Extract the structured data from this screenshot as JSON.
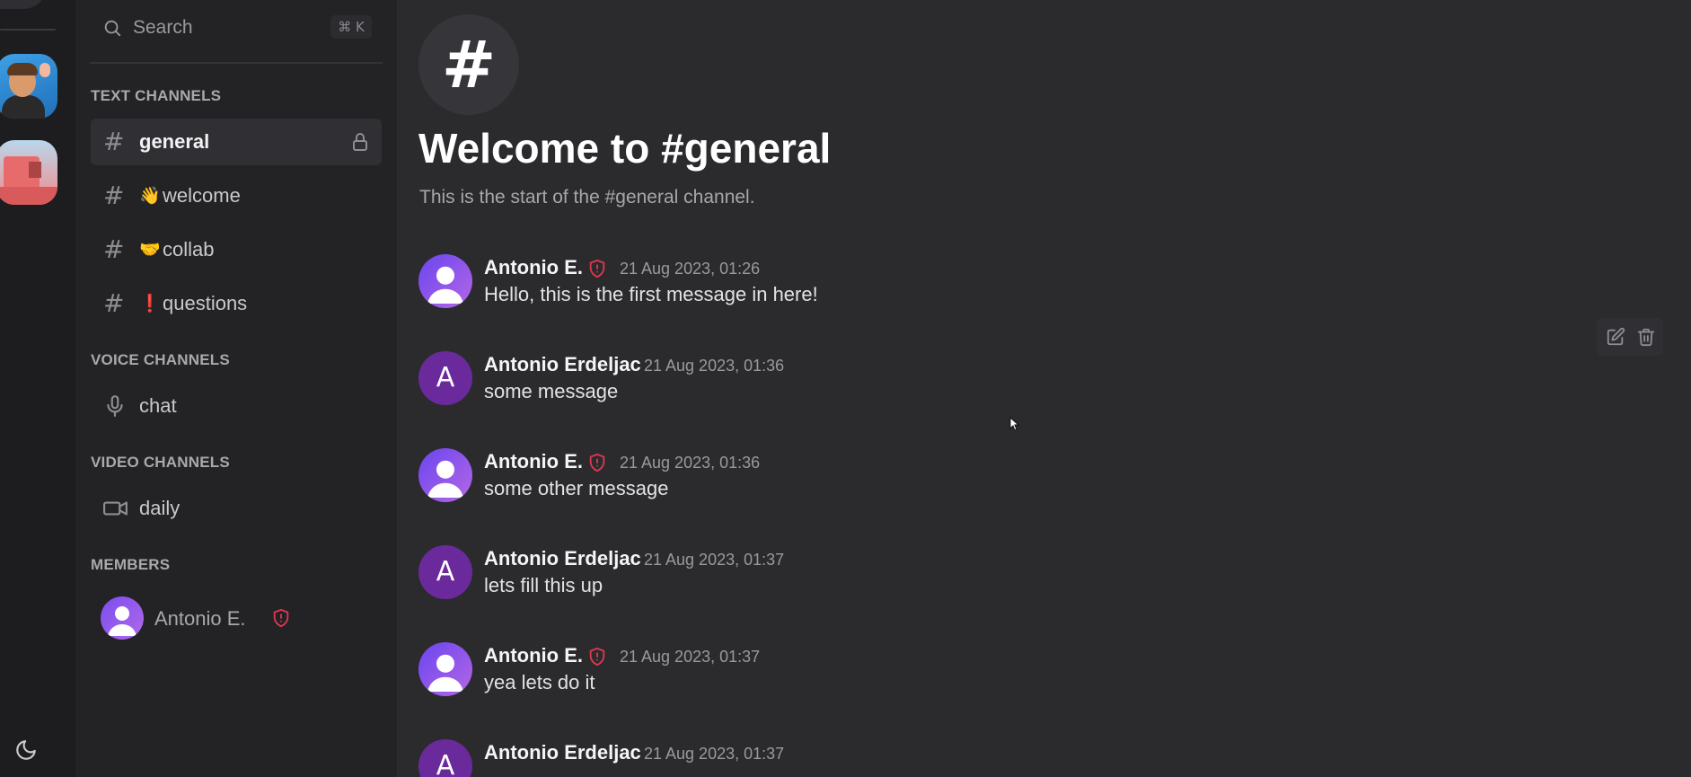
{
  "search": {
    "placeholder": "Search",
    "shortcut": "⌘ K"
  },
  "sections": {
    "text": "TEXT CHANNELS",
    "voice": "VOICE CHANNELS",
    "video": "VIDEO CHANNELS",
    "members": "MEMBERS"
  },
  "text_channels": [
    {
      "label": "general",
      "emoji": "",
      "active": true,
      "locked": true
    },
    {
      "label": "welcome",
      "emoji": "👋",
      "active": false
    },
    {
      "label": "collab",
      "emoji": "🤝",
      "active": false
    },
    {
      "label": "questions",
      "emoji": "❗",
      "active": false
    }
  ],
  "voice_channels": [
    {
      "label": "chat"
    }
  ],
  "video_channels": [
    {
      "label": "daily"
    }
  ],
  "members": [
    {
      "name": "Antonio E.",
      "role_icon": "shield-icon"
    }
  ],
  "main": {
    "channel_symbol": "#",
    "welcome_title": "Welcome to #general",
    "start_text": "This is the start of the #general channel."
  },
  "messages": [
    {
      "author": "Antonio E.",
      "admin": true,
      "avatar": "person-icon",
      "time": "21 Aug 2023, 01:26",
      "text": "Hello, this is the first message in here!"
    },
    {
      "author": "Antonio Erdeljac",
      "admin": false,
      "avatar": "A",
      "time": "21 Aug 2023, 01:36",
      "text": "some message"
    },
    {
      "author": "Antonio E.",
      "admin": true,
      "avatar": "person-icon",
      "time": "21 Aug 2023, 01:36",
      "text": "some other message"
    },
    {
      "author": "Antonio Erdeljac",
      "admin": false,
      "avatar": "A",
      "time": "21 Aug 2023, 01:37",
      "text": "lets fill this up"
    },
    {
      "author": "Antonio E.",
      "admin": true,
      "avatar": "person-icon",
      "time": "21 Aug 2023, 01:37",
      "text": "yea lets do it"
    },
    {
      "author": "Antonio Erdeljac",
      "admin": false,
      "avatar": "A",
      "time": "21 Aug 2023, 01:37",
      "text": ""
    }
  ],
  "colors": {
    "admin_shield": "#e0374f",
    "avatar_gradient_start": "#6a45ef",
    "avatar_letter_bg": "#6a2a9b"
  }
}
